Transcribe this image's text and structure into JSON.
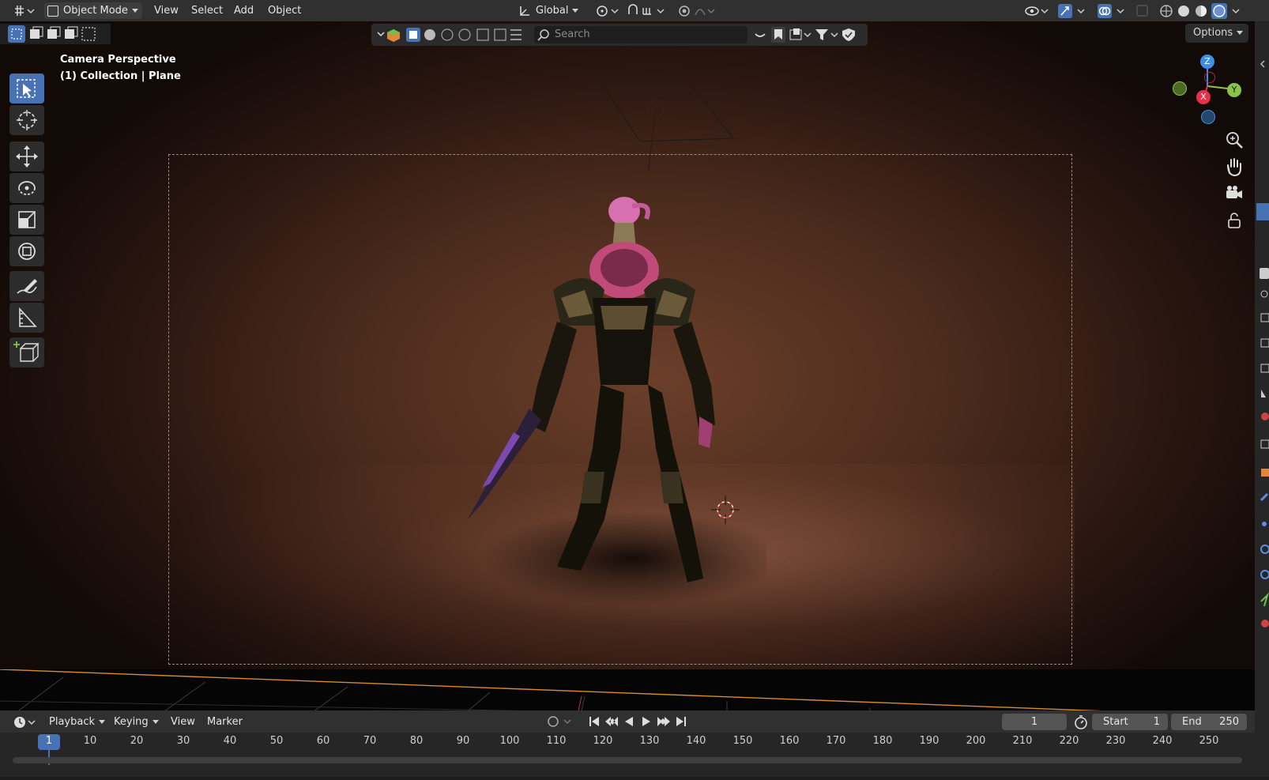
{
  "header": {
    "mode_label": "Object Mode",
    "menu": [
      "View",
      "Select",
      "Add",
      "Object"
    ],
    "transform_orientation": "Global"
  },
  "secondary_toolbar": {
    "search_placeholder": "Search",
    "options_label": "Options"
  },
  "viewport": {
    "overlay_title": "Camera Perspective",
    "overlay_collection": "(1) Collection | Plane"
  },
  "gizmo": {
    "z": "Z",
    "x": "X",
    "y": "Y"
  },
  "timeline": {
    "menu": [
      "Playback",
      "Keying",
      "View",
      "Marker"
    ],
    "current_frame": "1",
    "start_label": "Start",
    "start_value": "1",
    "end_label": "End",
    "end_value": "250",
    "ruler": [
      "1",
      "10",
      "20",
      "30",
      "40",
      "50",
      "60",
      "70",
      "80",
      "90",
      "100",
      "110",
      "120",
      "130",
      "140",
      "150",
      "160",
      "170",
      "180",
      "190",
      "200",
      "210",
      "220",
      "230",
      "240",
      "250"
    ]
  },
  "colors": {
    "accent": "#4772b3",
    "header_bg": "#303030",
    "axis_x": "#e8304a",
    "axis_y": "#8bc34a",
    "axis_z": "#3f8ee6"
  }
}
